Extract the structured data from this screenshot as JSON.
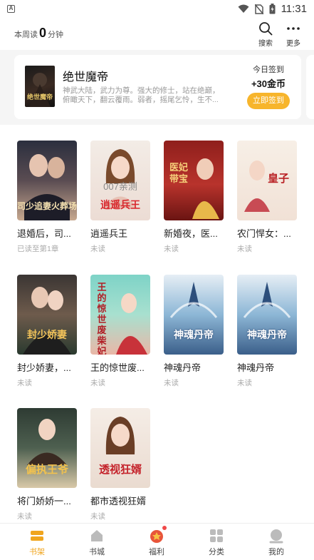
{
  "status_bar": {
    "time": "11:31",
    "app_icon_letter": "A"
  },
  "header": {
    "week_prefix": "本周读",
    "week_minutes": "0",
    "week_suffix": "分钟",
    "search_label": "搜索",
    "more_label": "更多"
  },
  "sign_card": {
    "book_title": "绝世魔帝",
    "cover_text": "绝世魔帝",
    "description": "神武大陆，武力为尊。强大的修士，站在绝巅，俯瞰天下，翻云覆雨。弱者，摇尾乞怜，生不...",
    "today_label": "今日签到",
    "reward": "+30金币",
    "button": "立即签到"
  },
  "books": [
    {
      "title": "退婚后，司...",
      "status": "已读至第1章",
      "cover_text": "司少追妻火葬场"
    },
    {
      "title": "逍遥兵王",
      "status": "未读",
      "cover_text": "逍遥兵王",
      "watermark": "007亲测"
    },
    {
      "title": "新婚夜，医...",
      "status": "未读",
      "cover_text": "医妃带宝"
    },
    {
      "title": "农门悍女：...",
      "status": "未读",
      "cover_text": "皇子"
    },
    {
      "title": "封少娇妻，...",
      "status": "未读",
      "cover_text": "封少娇妻"
    },
    {
      "title": "王的惊世废...",
      "status": "未读",
      "cover_text": "王的惊世废柴妃"
    },
    {
      "title": "神魂丹帝",
      "status": "未读",
      "cover_text": "神魂丹帝"
    },
    {
      "title": "神魂丹帝",
      "status": "未读",
      "cover_text": "神魂丹帝"
    },
    {
      "title": "将门娇娇一...",
      "status": "未读",
      "cover_text": "偏执王爷"
    },
    {
      "title": "都市透视狂婿",
      "status": "未读",
      "cover_text": "透视狂婿"
    }
  ],
  "tabs": [
    {
      "label": "书架",
      "icon": "bookshelf-icon",
      "active": true
    },
    {
      "label": "书城",
      "icon": "bookstore-icon"
    },
    {
      "label": "福利",
      "icon": "gift-icon"
    },
    {
      "label": "分类",
      "icon": "category-icon"
    },
    {
      "label": "我的",
      "icon": "profile-icon"
    }
  ],
  "colors": {
    "accent": "#f0a51e",
    "sign_button": "#f7b52c",
    "badge": "#f04848"
  }
}
